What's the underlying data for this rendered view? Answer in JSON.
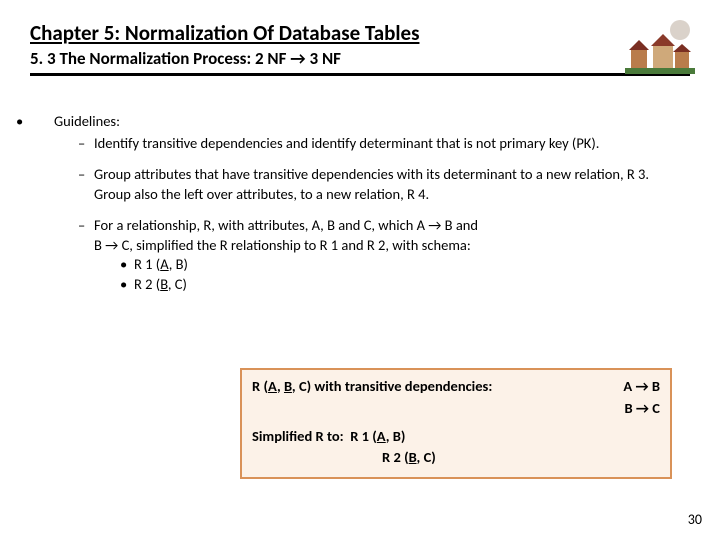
{
  "header": {
    "title": "Chapter 5: Normalization Of Database Tables",
    "subtitle": "5. 3 The Normalization Process: 2 NF → 3 NF"
  },
  "content": {
    "guidelines_label": "Guidelines:",
    "g1": "Identify transitive dependencies  and identify determinant that is not primary key (PK).",
    "g2a": "Group attributes that have transitive dependencies with its determinant to a new relation, R 3.",
    "g2b": "Group also the left over attributes, to a new relation, R 4.",
    "g3a": "For a relationship, R, with attributes, A, B and C, which A → B and",
    "g3b": "B → C, simplified the R relationship to R 1 and R 2, with schema:",
    "r1_prefix": "R 1 (",
    "r1_pk": "A",
    "r1_rest": ", B)",
    "r2_prefix": "R 2 (",
    "r2_pk": "B",
    "r2_rest": ", C)"
  },
  "box": {
    "line1_left_prefix": "R (",
    "line1_left_mid": ", ",
    "line1_left_tail": ", C) with transitive dependencies:",
    "a": "A",
    "b": "B",
    "dep1": "A → B",
    "dep2": "B → C",
    "simp_label": "Simplified R to:",
    "s1_prefix": "R 1 (",
    "s1_pk": "A",
    "s1_rest": ", B)",
    "s2_prefix": "R 2 (",
    "s2_pk": "B",
    "s2_rest": ", C)"
  },
  "pagenum": "30"
}
